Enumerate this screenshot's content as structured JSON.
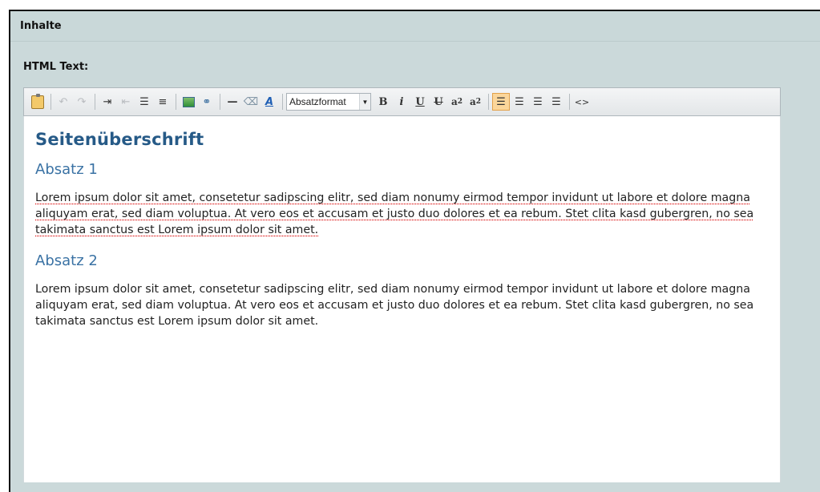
{
  "panel": {
    "title": "Inhalte"
  },
  "field": {
    "label": "HTML Text:"
  },
  "toolbar": {
    "format_select": "Absatzformat",
    "bold": "B",
    "italic": "i",
    "underline": "U",
    "strike": "U",
    "superscript_base": "a",
    "superscript_exp": "2",
    "subscript_base": "a",
    "subscript_exp": "2",
    "source": "<>",
    "hr": "—",
    "icons": [
      "paste-icon",
      "undo-icon",
      "redo-icon",
      "indent-icon",
      "outdent-icon",
      "ordered-list-icon",
      "unordered-list-icon",
      "insert-image-icon",
      "link-icon",
      "horizontal-rule-icon",
      "eraser-icon",
      "font-color-icon",
      "align-left-icon",
      "align-center-icon",
      "align-right-icon",
      "justify-icon",
      "source-code-icon"
    ],
    "active_button": "align-left"
  },
  "content": {
    "heading": "Seitenüberschrift",
    "section1_title": "Absatz 1",
    "section1_text": "Lorem ipsum dolor sit amet, consetetur sadipscing elitr, sed diam nonumy eirmod tempor invidunt ut labore et dolore magna aliquyam erat, sed diam voluptua. At vero eos et accusam et justo duo dolores et ea rebum. Stet clita kasd gubergren, no sea takimata sanctus est Lorem ipsum dolor sit amet.",
    "section2_title": "Absatz 2",
    "section2_text": "Lorem ipsum dolor sit amet, consetetur sadipscing elitr, sed diam nonumy eirmod tempor invidunt ut labore et dolore magna aliquyam erat, sed diam voluptua. At vero eos et accusam et justo duo dolores et ea rebum. Stet clita kasd gubergren, no sea takimata sanctus est Lorem ipsum dolor sit amet."
  },
  "colors": {
    "panel_bg": "#cbd9da",
    "heading": "#265a87",
    "subheading": "#3a72a4",
    "active": "#fbd69a"
  }
}
